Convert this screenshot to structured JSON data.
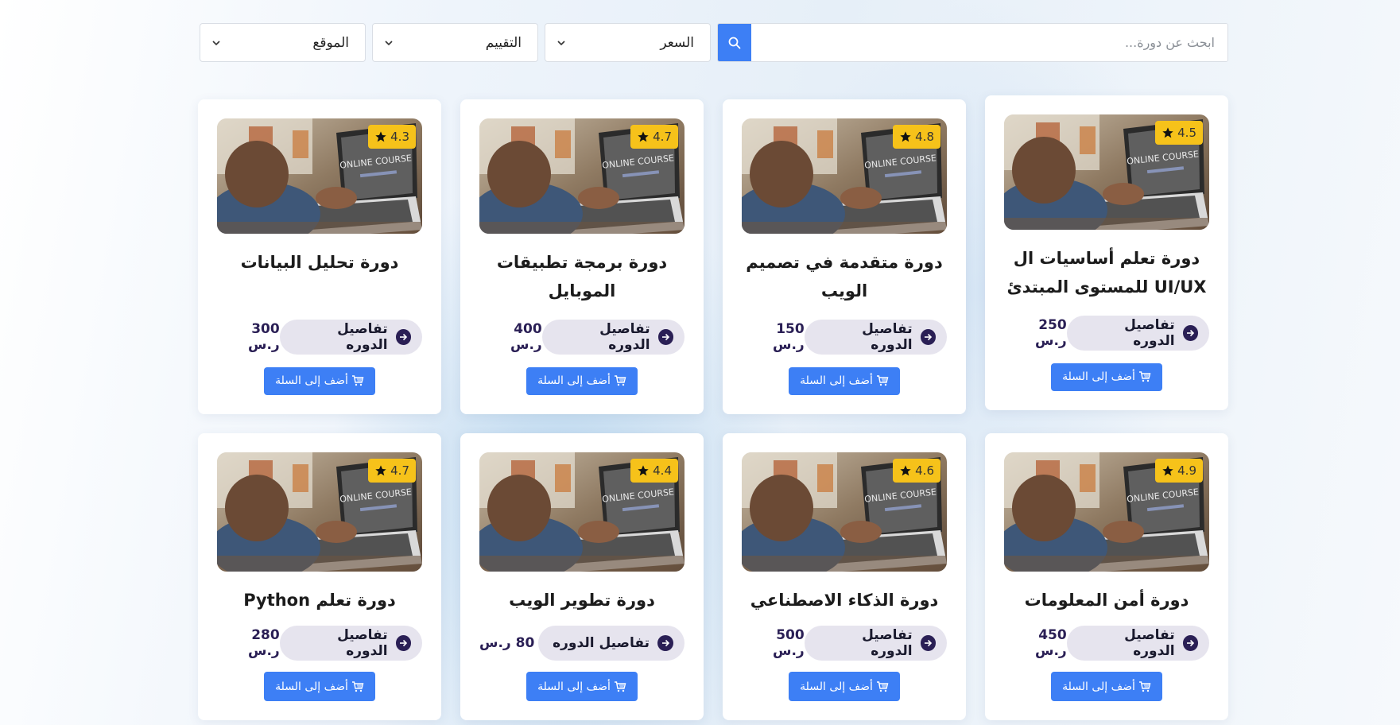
{
  "search": {
    "placeholder": "ابحث عن دورة..."
  },
  "filters": [
    {
      "label": "السعر"
    },
    {
      "label": "التقييم"
    },
    {
      "label": "الموقع"
    }
  ],
  "course_card": {
    "details_label": "تفاصيل الدوره",
    "cart_label": "أضف إلى السلة",
    "thumbnail_text": "ONLINE COURSE"
  },
  "courses": [
    {
      "title": "دورة تعلم أساسيات ال UI/UX للمستوى المبتدئ",
      "rating": "4.5",
      "price": "250 ر.س"
    },
    {
      "title": "دورة متقدمة في تصميم الويب",
      "rating": "4.8",
      "price": "150 ر.س"
    },
    {
      "title": "دورة برمجة تطبيقات الموبايل",
      "rating": "4.7",
      "price": "400 ر.س"
    },
    {
      "title": "دورة تحليل البيانات",
      "rating": "4.3",
      "price": "300 ر.س"
    },
    {
      "title": "دورة أمن المعلومات",
      "rating": "4.9",
      "price": "450 ر.س"
    },
    {
      "title": "دورة الذكاء الاصطناعي",
      "rating": "4.6",
      "price": "500 ر.س"
    },
    {
      "title": "دورة تطوير الويب",
      "rating": "4.4",
      "price": "80 ر.س"
    },
    {
      "title": "دورة تعلم Python",
      "rating": "4.7",
      "price": "280 ر.س"
    }
  ],
  "colors": {
    "accent": "#3d7ff5",
    "rating_badge": "#f6c21a",
    "details_pill": "#e6e4ee",
    "price_text": "#2a1f55"
  }
}
